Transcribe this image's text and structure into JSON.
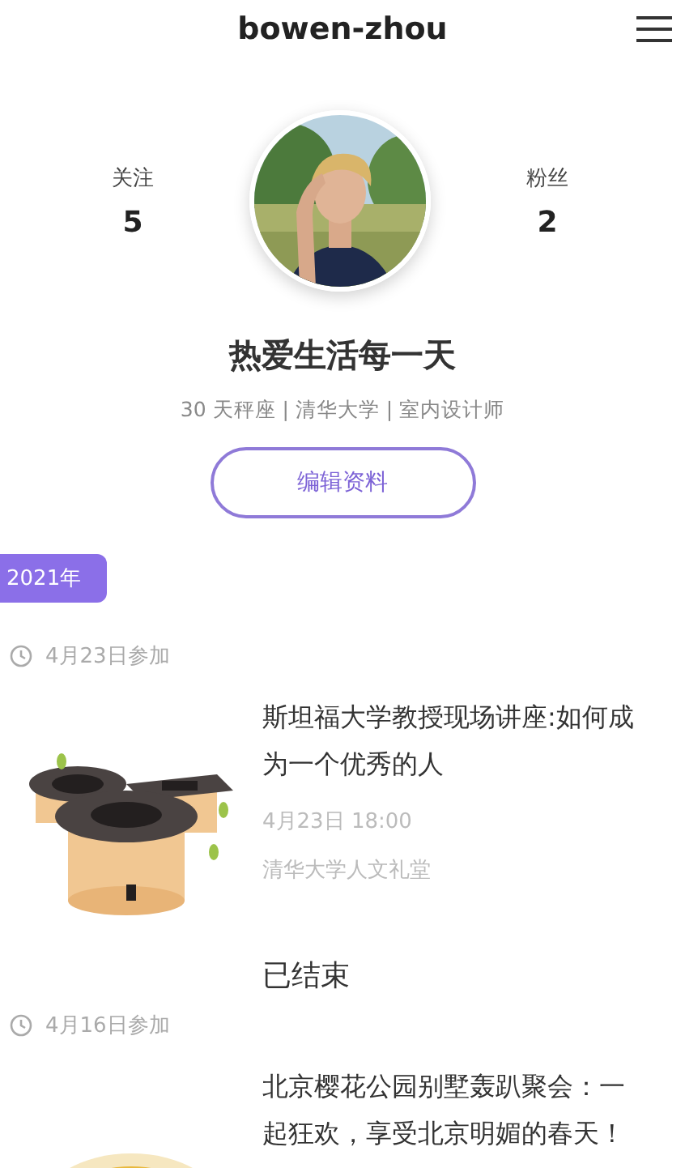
{
  "header": {
    "title": "bowen-zhou"
  },
  "stats": [
    {
      "label": "关注",
      "value": "5"
    },
    {
      "label": "粉丝",
      "value": "2"
    }
  ],
  "profile": {
    "name": "热爱生活每一天",
    "details": "30 天秤座 | 清华大学 | 室内设计师",
    "edit_button": "编辑资料"
  },
  "timeline": {
    "year_tag": "2021年",
    "entries": [
      {
        "joined": "4月23日参加",
        "event": {
          "kind": "tulou",
          "title": "斯坦福大学教授现场讲座:如何成为一个优秀的人",
          "time": "4月23日 18:00",
          "place": "清华大学人文礼堂",
          "status": "已结束"
        }
      },
      {
        "joined": "4月16日参加",
        "event": {
          "kind": "dish",
          "title": "北京樱花公园别墅轰趴聚会：一起狂欢，享受北京明媚的春天！"
        }
      }
    ]
  }
}
